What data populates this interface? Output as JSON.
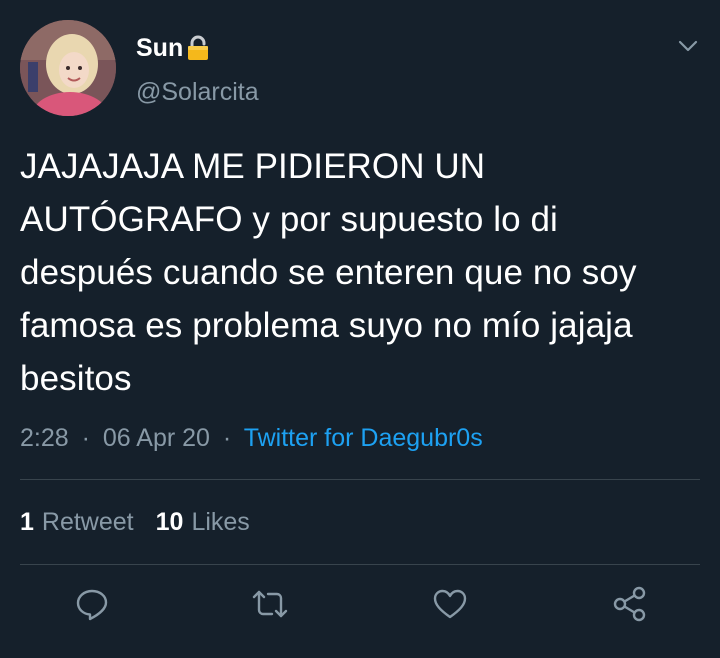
{
  "colors": {
    "background": "#15202b",
    "text_primary": "#ffffff",
    "text_secondary": "#8899a6",
    "link": "#1da1f2",
    "divider": "#38444d"
  },
  "tweet": {
    "author": {
      "display_name": "Sun",
      "handle": "@Solarcita",
      "avatar_icon": "profile-photo",
      "protected_icon": "lock-icon"
    },
    "text": "JAJAJAJA ME PIDIERON UN AUTÓGRAFO y por supuesto lo di después cuando se enteren que no soy famosa es problema suyo no mío jajaja besitos",
    "time": "2:28",
    "date": "06 Apr 20",
    "separator": "·",
    "source": "Twitter for Daegubr0s",
    "stats": {
      "retweets_count": "1",
      "retweets_label": "Retweet",
      "likes_count": "10",
      "likes_label": "Likes"
    },
    "actions": [
      "reply-icon",
      "retweet-icon",
      "like-icon",
      "share-icon"
    ]
  }
}
